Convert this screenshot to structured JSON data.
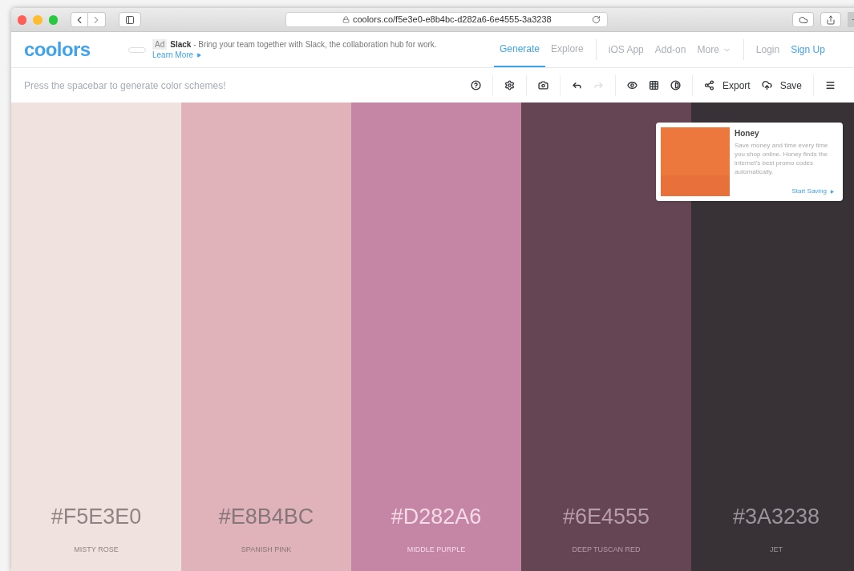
{
  "browser": {
    "url": "coolors.co/f5e3e0-e8b4bc-d282a6-6e4555-3a3238"
  },
  "header": {
    "logo": "coolors",
    "ad": {
      "badge": "Ad",
      "sponsor": "Slack",
      "text": " - Bring your team together with Slack, the collaboration hub for work.",
      "link": "Learn More"
    },
    "nav": [
      {
        "label": "Generate",
        "selected": true
      },
      {
        "label": "Explore",
        "selected": false
      }
    ],
    "extras": [
      "iOS App",
      "Add-on",
      "More"
    ],
    "auth": [
      {
        "label": "Login",
        "kind": "plain"
      },
      {
        "label": "Sign Up",
        "kind": "primary"
      }
    ]
  },
  "toolbar": {
    "hint": "Press the spacebar to generate color schemes!",
    "buttons": [
      {
        "disabled": false
      },
      {
        "disabled": false
      },
      {
        "disabled": false
      },
      {
        "disabled": false
      },
      {
        "disabled": true
      },
      {
        "disabled": false
      },
      {
        "disabled": false
      },
      {
        "disabled": false
      },
      {
        "label": "Export",
        "disabled": false
      },
      {
        "label": "Save",
        "disabled": false
      },
      {
        "disabled": false
      }
    ]
  },
  "swatches": [
    {
      "hex": "#F5E3E0",
      "name": "MISTY ROSE",
      "color": "#f0e2df"
    },
    {
      "hex": "#E8B4BC",
      "name": "SPANISH PINK",
      "color": "#dfb3b9"
    },
    {
      "hex": "#D282A6",
      "name": "MIDDLE PURPLE",
      "color": "#c585a5"
    },
    {
      "hex": "#6E4555",
      "name": "DEEP TUSCAN RED",
      "color": "#654553"
    },
    {
      "hex": "#3A3238",
      "name": "JET",
      "color": "#383237"
    }
  ],
  "ad_card": {
    "title": "Honey",
    "text": "Save money and time every time you shop online. Honey finds the internet's best promo codes automatically.",
    "link": "Start Saving"
  }
}
